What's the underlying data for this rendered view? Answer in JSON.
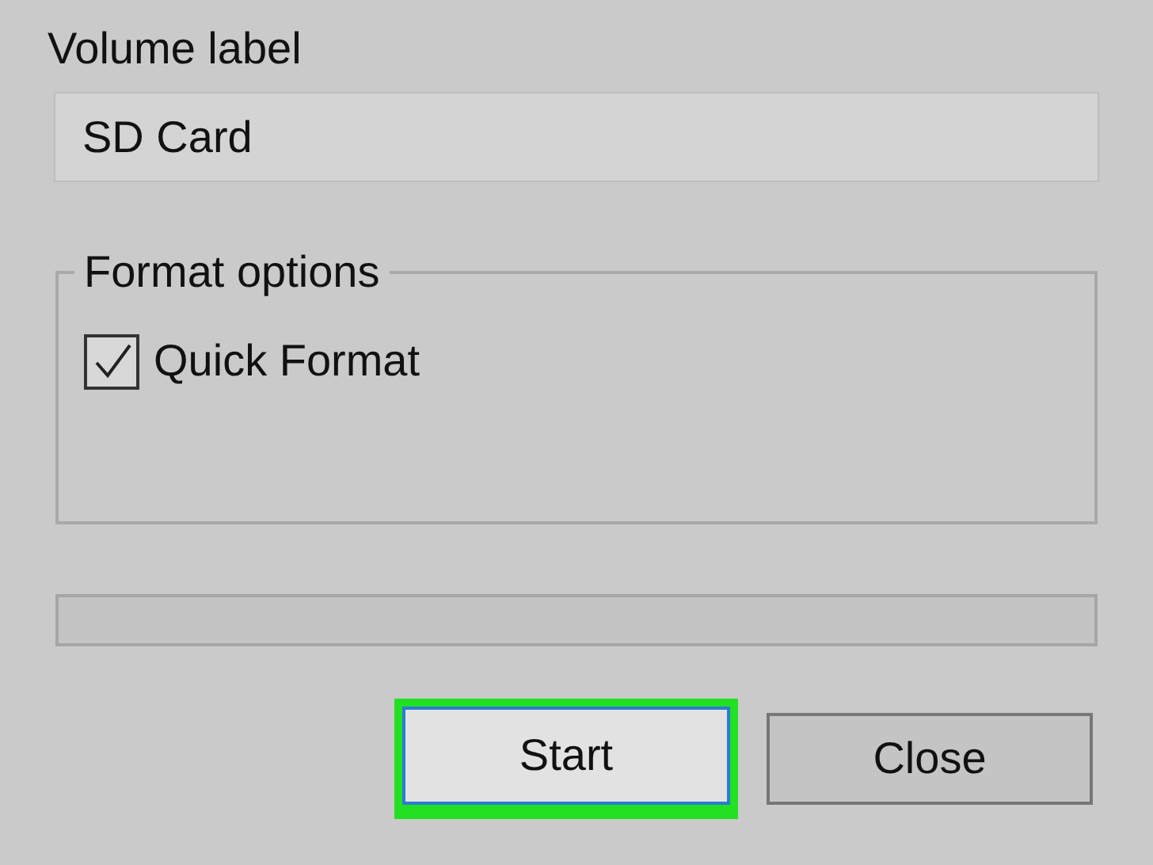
{
  "volume_label": {
    "label": "Volume label",
    "value": "SD Card"
  },
  "format_options": {
    "title": "Format options",
    "options": [
      {
        "label": "Quick Format",
        "checked": true
      }
    ]
  },
  "progress": {
    "level": 0
  },
  "buttons": [
    {
      "label": "Start",
      "highlighted": true
    },
    {
      "label": "Close",
      "highlighted": false
    }
  ]
}
